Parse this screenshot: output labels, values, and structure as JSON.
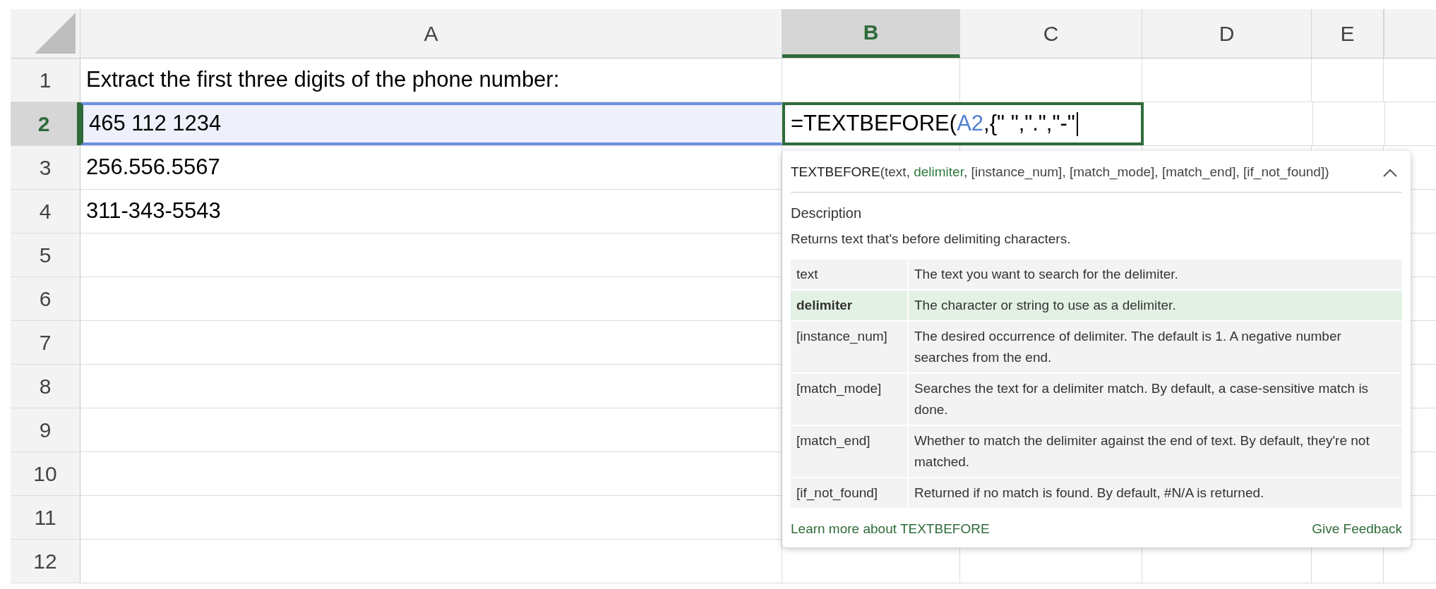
{
  "columns": [
    {
      "label": "A",
      "selected": false
    },
    {
      "label": "B",
      "selected": true
    },
    {
      "label": "C",
      "selected": false
    },
    {
      "label": "D",
      "selected": false
    },
    {
      "label": "E",
      "selected": false
    }
  ],
  "rows": [
    {
      "label": "1",
      "selected": false,
      "cells": [
        "Extract the first three digits of the phone number:"
      ]
    },
    {
      "label": "2",
      "selected": true,
      "cells": [
        "465 112 1234"
      ]
    },
    {
      "label": "3",
      "selected": false,
      "cells": [
        "256.556.5567"
      ]
    },
    {
      "label": "4",
      "selected": false,
      "cells": [
        "311-343-5543"
      ]
    },
    {
      "label": "5",
      "selected": false,
      "cells": []
    },
    {
      "label": "6",
      "selected": false,
      "cells": []
    },
    {
      "label": "7",
      "selected": false,
      "cells": []
    },
    {
      "label": "8",
      "selected": false,
      "cells": []
    },
    {
      "label": "9",
      "selected": false,
      "cells": []
    },
    {
      "label": "10",
      "selected": false,
      "cells": []
    },
    {
      "label": "11",
      "selected": false,
      "cells": []
    },
    {
      "label": "12",
      "selected": false,
      "cells": []
    }
  ],
  "formula": [
    {
      "kind": "text",
      "text": "=TEXTBEFORE("
    },
    {
      "kind": "ref",
      "text": "A2"
    },
    {
      "kind": "text",
      "text": ",{\" \",\".\",\"-\""
    }
  ],
  "tooltip": {
    "signature": [
      {
        "kind": "name",
        "text": "TEXTBEFORE"
      },
      {
        "kind": "text",
        "text": "("
      },
      {
        "kind": "param",
        "text": "text",
        "current": false
      },
      {
        "kind": "text",
        "text": ", "
      },
      {
        "kind": "param",
        "text": "delimiter",
        "current": true
      },
      {
        "kind": "text",
        "text": ", "
      },
      {
        "kind": "param",
        "text": "[instance_num]",
        "current": false
      },
      {
        "kind": "text",
        "text": ", "
      },
      {
        "kind": "param",
        "text": "[match_mode]",
        "current": false
      },
      {
        "kind": "text",
        "text": ", "
      },
      {
        "kind": "param",
        "text": "[match_end]",
        "current": false
      },
      {
        "kind": "text",
        "text": ", "
      },
      {
        "kind": "param",
        "text": "[if_not_found]",
        "current": false
      },
      {
        "kind": "text",
        "text": ")"
      }
    ],
    "description_label": "Description",
    "description": "Returns text that's before delimiting characters.",
    "arguments": [
      {
        "name": "text",
        "text": "The text you want to search for the delimiter.",
        "selected": false
      },
      {
        "name": "delimiter",
        "text": "The character or string to use as a delimiter.",
        "selected": true
      },
      {
        "name": "[instance_num]",
        "text": "The desired occurrence of delimiter. The default is 1. A negative number searches from the end.",
        "selected": false
      },
      {
        "name": "[match_mode]",
        "text": "Searches the text for a delimiter match. By default, a case-sensitive match is done.",
        "selected": false
      },
      {
        "name": "[match_end]",
        "text": "Whether to match the delimiter against the end of text. By default, they're not matched.",
        "selected": false
      },
      {
        "name": "[if_not_found]",
        "text": "Returned if no match is found. By default, #N/A is returned.",
        "selected": false
      }
    ],
    "learn_more": "Learn more about TEXTBEFORE",
    "feedback": "Give Feedback"
  }
}
